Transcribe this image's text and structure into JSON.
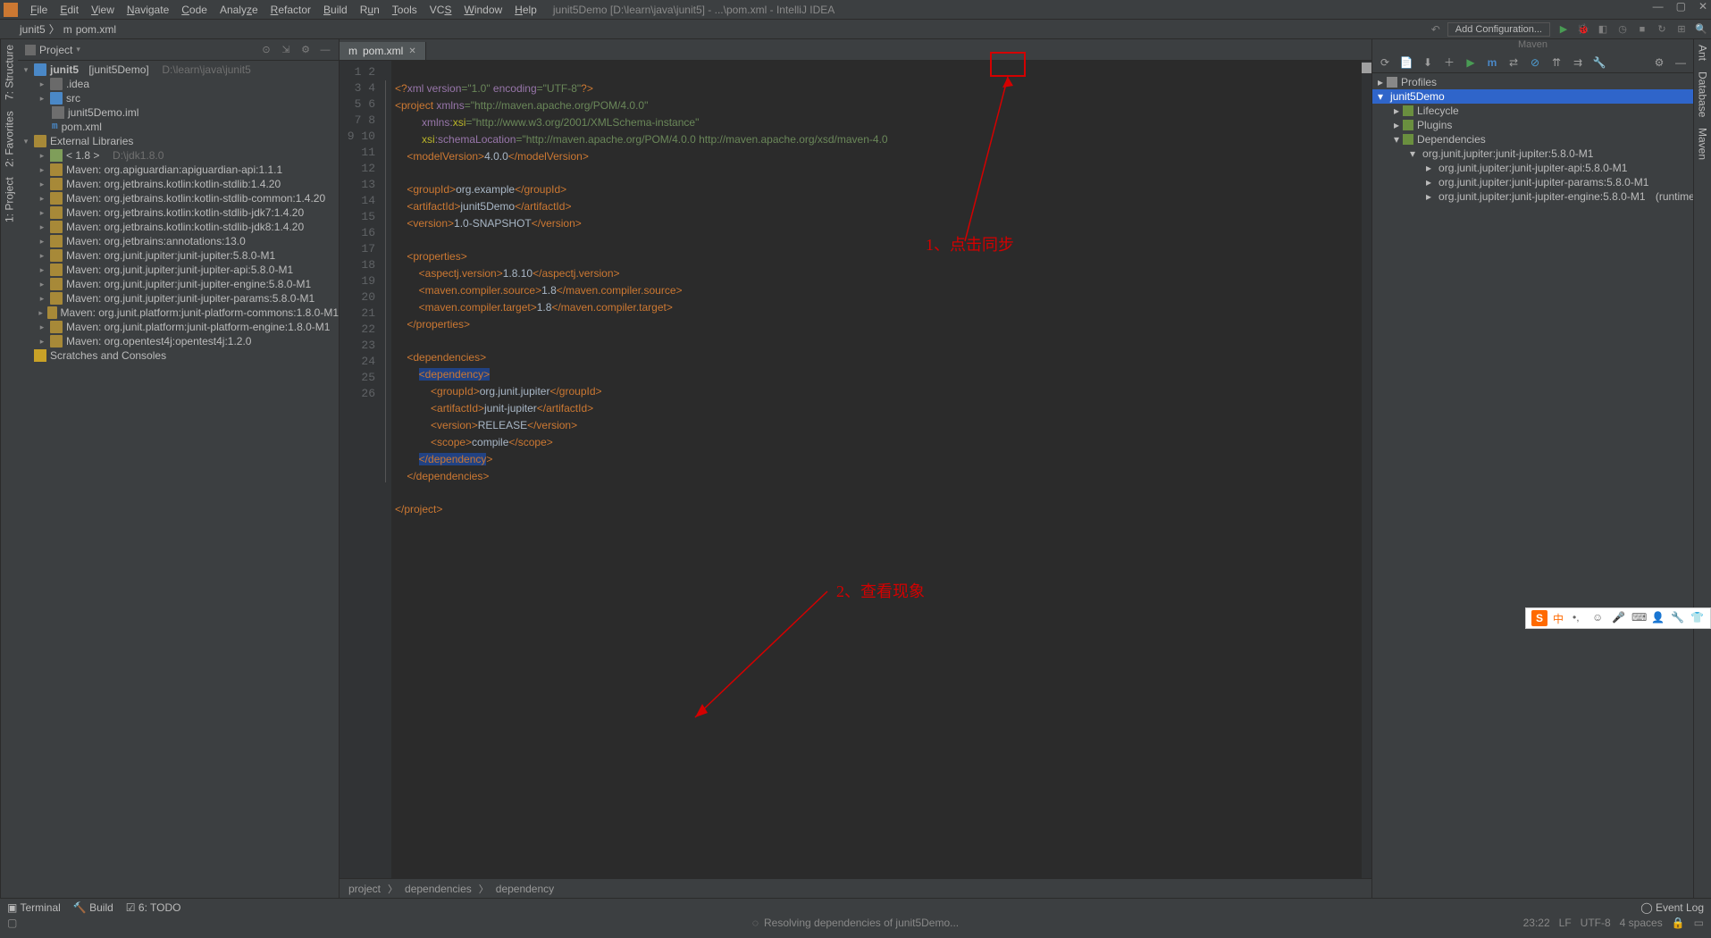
{
  "menu": {
    "items": [
      "File",
      "Edit",
      "View",
      "Navigate",
      "Code",
      "Analyze",
      "Refactor",
      "Build",
      "Run",
      "Tools",
      "VCS",
      "Window",
      "Help"
    ],
    "title": "junit5Demo [D:\\learn\\java\\junit5] - ...\\pom.xml - IntelliJ IDEA"
  },
  "nav": {
    "crumb1": "junit5",
    "crumb2": "pom.xml",
    "add_config": "Add Configuration..."
  },
  "project": {
    "header": "Project",
    "root_name": "junit5",
    "root_module": "[junit5Demo]",
    "root_path": "D:\\learn\\java\\junit5",
    "idea": ".idea",
    "src": "src",
    "iml": "junit5Demo.iml",
    "pom": "pom.xml",
    "ext_libs": "External Libraries",
    "jdk": "< 1.8 >",
    "jdk_path": "D:\\jdk1.8.0",
    "libs": [
      "Maven: org.apiguardian:apiguardian-api:1.1.1",
      "Maven: org.jetbrains.kotlin:kotlin-stdlib:1.4.20",
      "Maven: org.jetbrains.kotlin:kotlin-stdlib-common:1.4.20",
      "Maven: org.jetbrains.kotlin:kotlin-stdlib-jdk7:1.4.20",
      "Maven: org.jetbrains.kotlin:kotlin-stdlib-jdk8:1.4.20",
      "Maven: org.jetbrains:annotations:13.0",
      "Maven: org.junit.jupiter:junit-jupiter:5.8.0-M1",
      "Maven: org.junit.jupiter:junit-jupiter-api:5.8.0-M1",
      "Maven: org.junit.jupiter:junit-jupiter-engine:5.8.0-M1",
      "Maven: org.junit.jupiter:junit-jupiter-params:5.8.0-M1",
      "Maven: org.junit.platform:junit-platform-commons:1.8.0-M1",
      "Maven: org.junit.platform:junit-platform-engine:1.8.0-M1",
      "Maven: org.opentest4j:opentest4j:1.2.0"
    ],
    "scratches": "Scratches and Consoles"
  },
  "editor": {
    "tab": "pom.xml",
    "lines": 26,
    "crumb": [
      "project",
      "dependencies",
      "dependency"
    ]
  },
  "maven": {
    "title": "Maven",
    "profiles": "Profiles",
    "root": "junit5Demo",
    "lifecycle": "Lifecycle",
    "plugins": "Plugins",
    "deps": "Dependencies",
    "d1": "org.junit.jupiter:junit-jupiter:5.8.0-M1",
    "d2": "org.junit.jupiter:junit-jupiter-api:5.8.0-M1",
    "d3": "org.junit.jupiter:junit-jupiter-params:5.8.0-M1",
    "d4": "org.junit.jupiter:junit-jupiter-engine:5.8.0-M1",
    "runtime": "(runtime)"
  },
  "sidebars": {
    "left1": "1: Project",
    "left2": "2: Favorites",
    "left3": "7: Structure",
    "right1": "Ant",
    "right2": "Database",
    "right3": "Maven"
  },
  "bottom": {
    "terminal": "Terminal",
    "build": "Build",
    "todo": "6: TODO",
    "event": "Event Log"
  },
  "status": {
    "msg": "Resolving dependencies of junit5Demo...",
    "pos": "23:22",
    "lf": "LF",
    "enc": "UTF-8",
    "indent": "4 spaces"
  },
  "annotations": {
    "a1": "1、点击同步",
    "a2": "2、查看现象"
  },
  "code": {
    "l1a": "<?",
    "l1b": "xml version",
    "l1c": "=\"1.0\" ",
    "l1d": "encoding",
    "l1e": "=\"UTF-8\"",
    "l1f": "?>",
    "l2a": "<project ",
    "l2b": "xmlns",
    "l2c": "=\"http://maven.apache.org/POM/4.0.0\"",
    "l3a": "         ",
    "l3b": "xmlns:",
    "l3c": "xsi",
    "l3d": "=\"http://www.w3.org/2001/XMLSchema-instance\"",
    "l4a": "         ",
    "l4b": "xsi",
    "l4c": ":schemaLocation",
    "l4d": "=\"http://maven.apache.org/POM/4.0.0 http://maven.apache.org/xsd/maven-4.0",
    "l5a": "    <modelVersion>",
    "l5b": "4.0.0",
    "l5c": "</modelVersion>",
    "l7a": "    <groupId>",
    "l7b": "org.example",
    "l7c": "</groupId>",
    "l8a": "    <artifactId>",
    "l8b": "junit5Demo",
    "l8c": "</artifactId>",
    "l9a": "    <version>",
    "l9b": "1.0-SNAPSHOT",
    "l9c": "</version>",
    "l11a": "    <properties>",
    "l12a": "        <aspectj.version>",
    "l12b": "1.8.10",
    "l12c": "</aspectj.version>",
    "l13a": "        <maven.compiler.source>",
    "l13b": "1.8",
    "l13c": "</maven.compiler.source>",
    "l14a": "        <maven.compiler.target>",
    "l14b": "1.8",
    "l14c": "</maven.compiler.target>",
    "l15a": "    </properties>",
    "l17a": "    <dependencies>",
    "l18a": "        ",
    "l18b": "<dependency>",
    "l19a": "            <groupId>",
    "l19b": "org.junit.jupiter",
    "l19c": "</groupId>",
    "l20a": "            <artifactId>",
    "l20b": "junit-jupiter",
    "l20c": "</artifactId>",
    "l21a": "            <version>",
    "l21b": "RELEASE",
    "l21c": "</version>",
    "l22a": "            <scope>",
    "l22b": "compile",
    "l22c": "</scope>",
    "l23a": "        ",
    "l23b": "</dependency",
    "l23c": ">",
    "l24a": "    </dependencies>",
    "l26a": "</project>"
  }
}
